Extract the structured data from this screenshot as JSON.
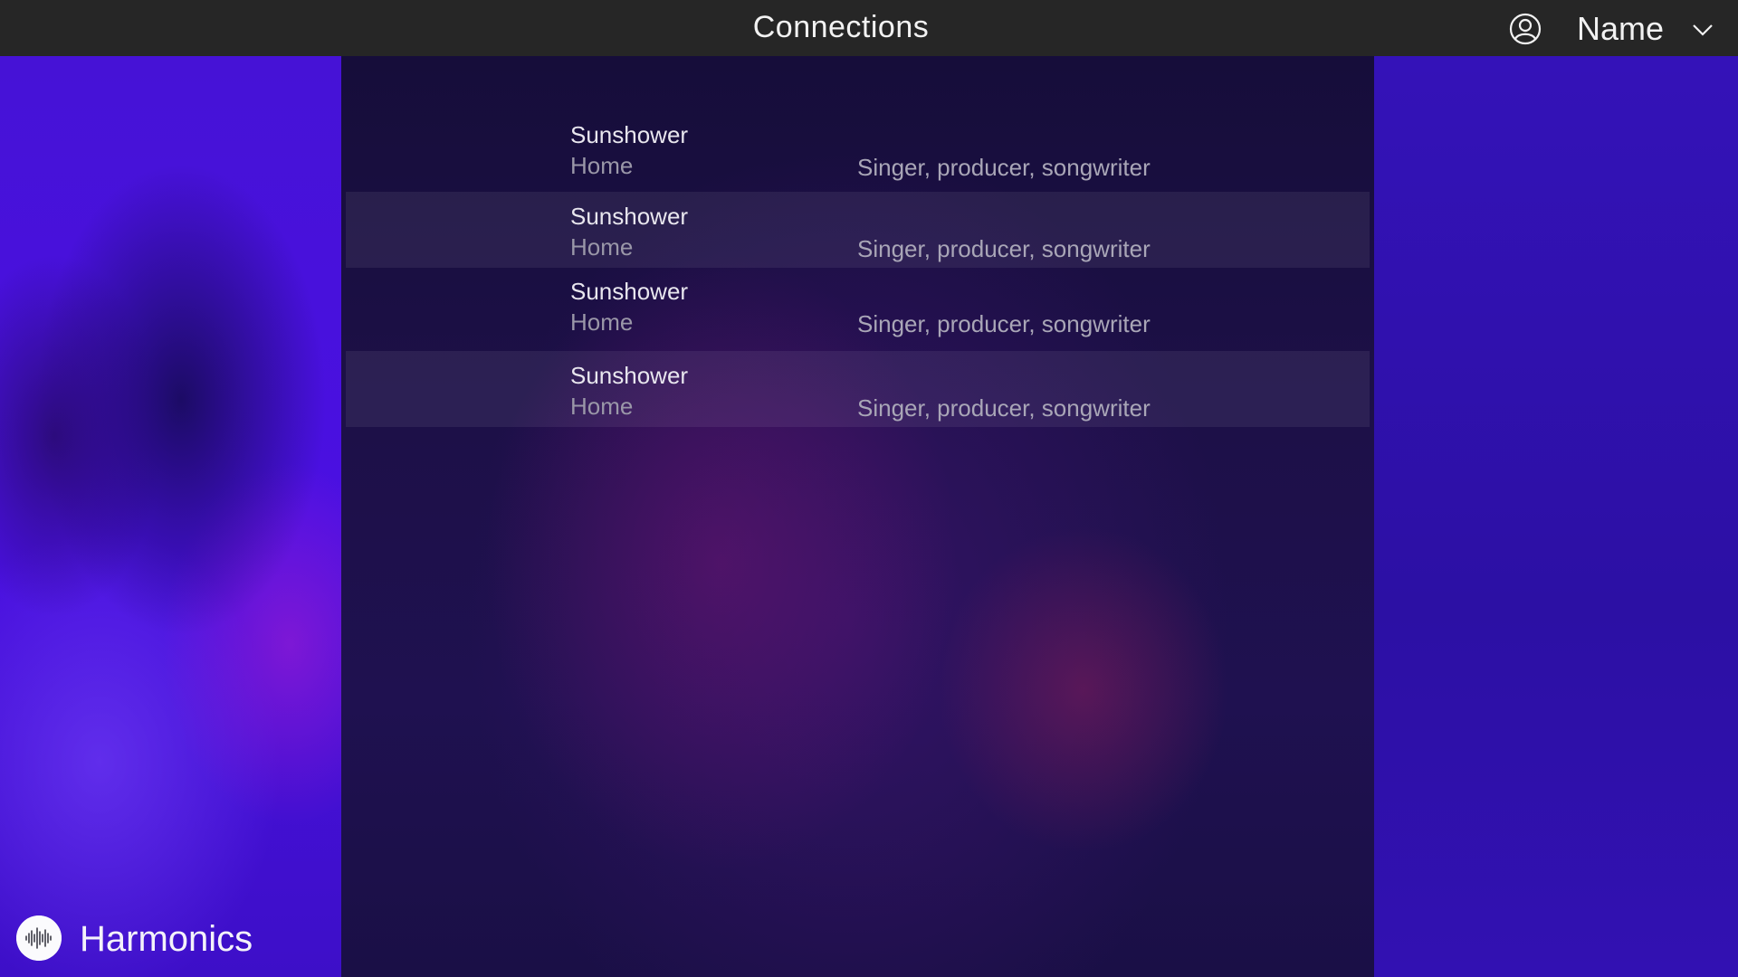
{
  "header": {
    "title": "Connections",
    "user_name": "Name",
    "account_icon": "user-circle-icon",
    "menu_icon": "chevron-down-icon"
  },
  "connections": [
    {
      "name": "Sunshower",
      "location": "Home",
      "role": "Singer, producer, songwriter"
    },
    {
      "name": "Sunshower",
      "location": "Home",
      "role": "Singer, producer, songwriter"
    },
    {
      "name": "Sunshower",
      "location": "Home",
      "role": "Singer, producer, songwriter"
    },
    {
      "name": "Sunshower",
      "location": "Home",
      "role": "Singer, producer, songwriter"
    }
  ],
  "brand": {
    "name": "Harmonics",
    "logo_icon": "waveform-icon"
  },
  "colors": {
    "topbar": "#262626",
    "side_panel": "#3311b8",
    "center_panel": "#1a0f46"
  }
}
